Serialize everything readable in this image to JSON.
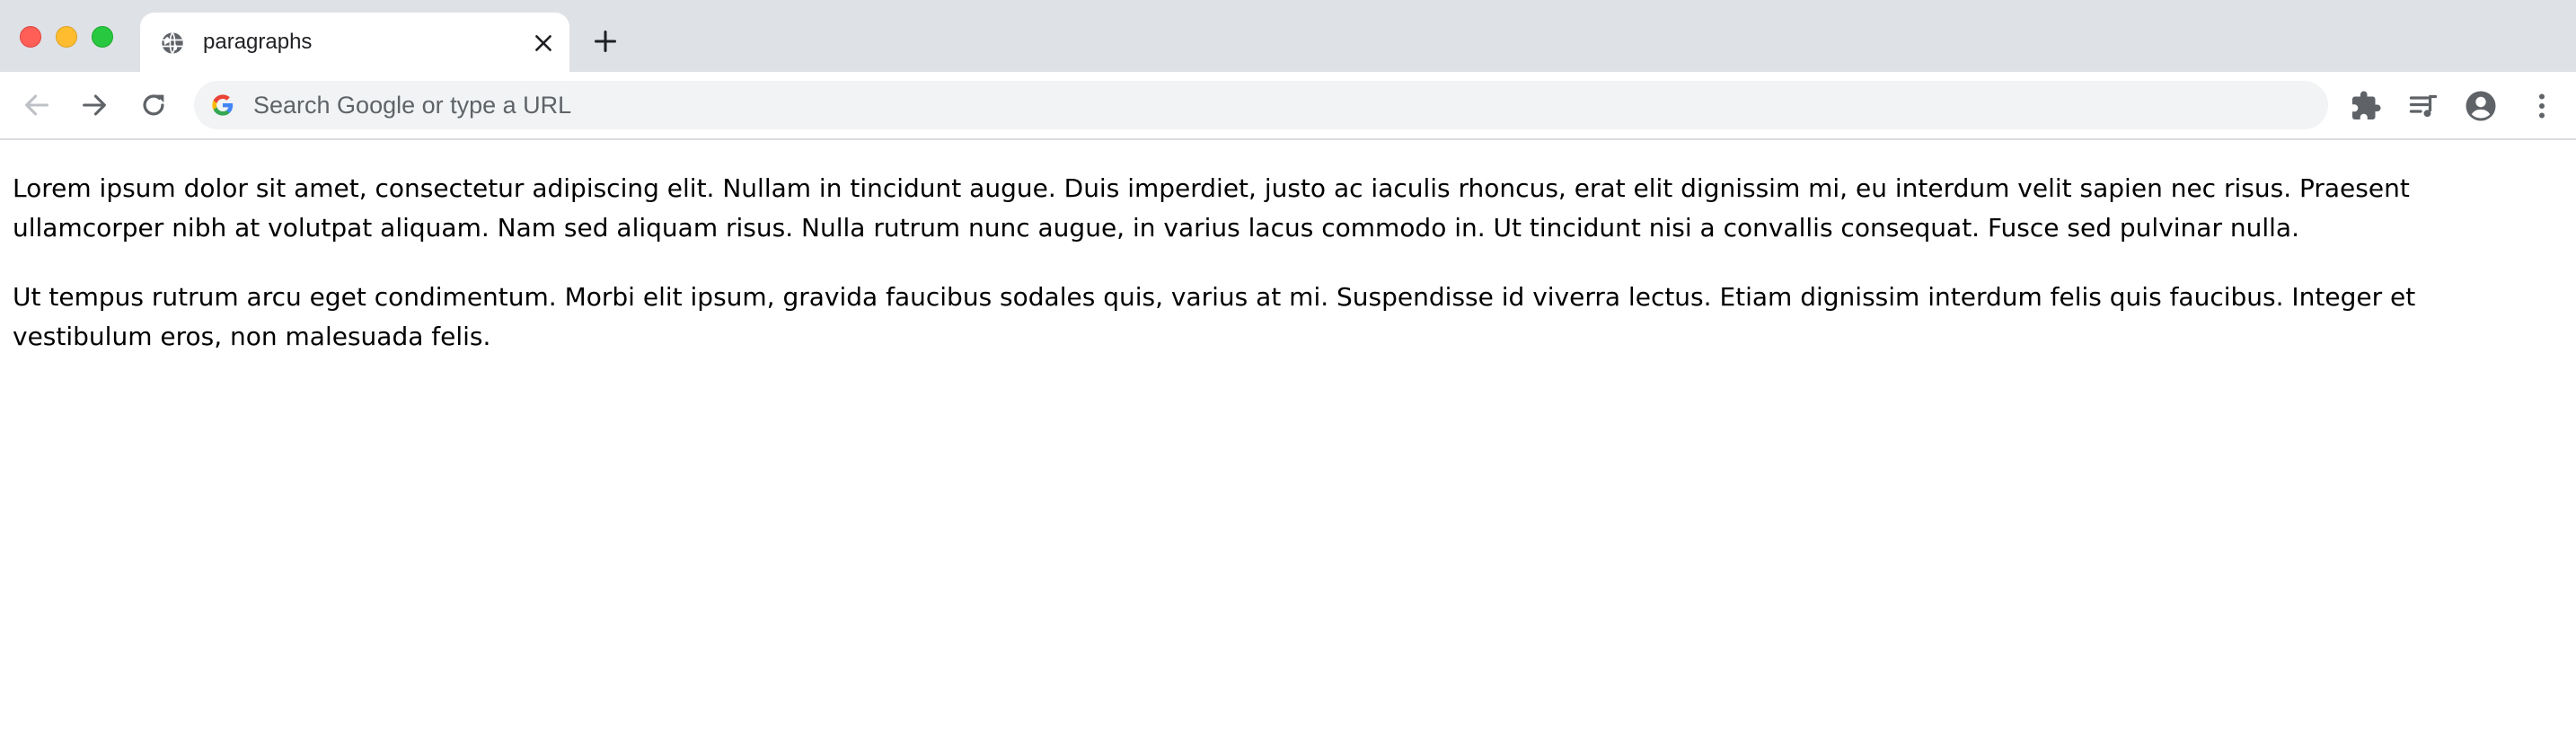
{
  "browser": {
    "tab": {
      "title": "paragraphs",
      "favicon": "globe-icon"
    },
    "new_tab_icon": "plus-icon",
    "toolbar": {
      "back_icon": "back-arrow-icon",
      "forward_icon": "forward-arrow-icon",
      "reload_icon": "reload-icon",
      "omnibox": {
        "placeholder": "Search Google or type a URL",
        "value": "",
        "logo": "google-logo-icon"
      },
      "extensions_icon": "puzzle-icon",
      "media_icon": "media-queue-icon",
      "profile_icon": "account-circle-icon",
      "menu_icon": "kebab-menu-icon"
    }
  },
  "page": {
    "paragraphs": [
      "Lorem ipsum dolor sit amet, consectetur adipiscing elit. Nullam in tincidunt augue. Duis imperdiet, justo ac iaculis rhoncus, erat elit dignissim mi, eu interdum velit sapien nec risus. Praesent ullamcorper nibh at volutpat aliquam. Nam sed aliquam risus. Nulla rutrum nunc augue, in varius lacus commodo in. Ut tincidunt nisi a convallis consequat. Fusce sed pulvinar nulla.",
      "Ut tempus rutrum arcu eget condimentum. Morbi elit ipsum, gravida faucibus sodales quis, varius at mi. Suspendisse id viverra lectus. Etiam dignissim interdum felis quis faucibus. Integer et vestibulum eros, non malesuada felis."
    ]
  },
  "colors": {
    "tabstrip": "#dee1e6",
    "omnibox": "#f1f3f4",
    "icon": "#5f6368",
    "disabled_icon": "#bdc1c6",
    "close_button": "#ff5f57",
    "minimize_button": "#febc2e",
    "maximize_button": "#28c840"
  }
}
